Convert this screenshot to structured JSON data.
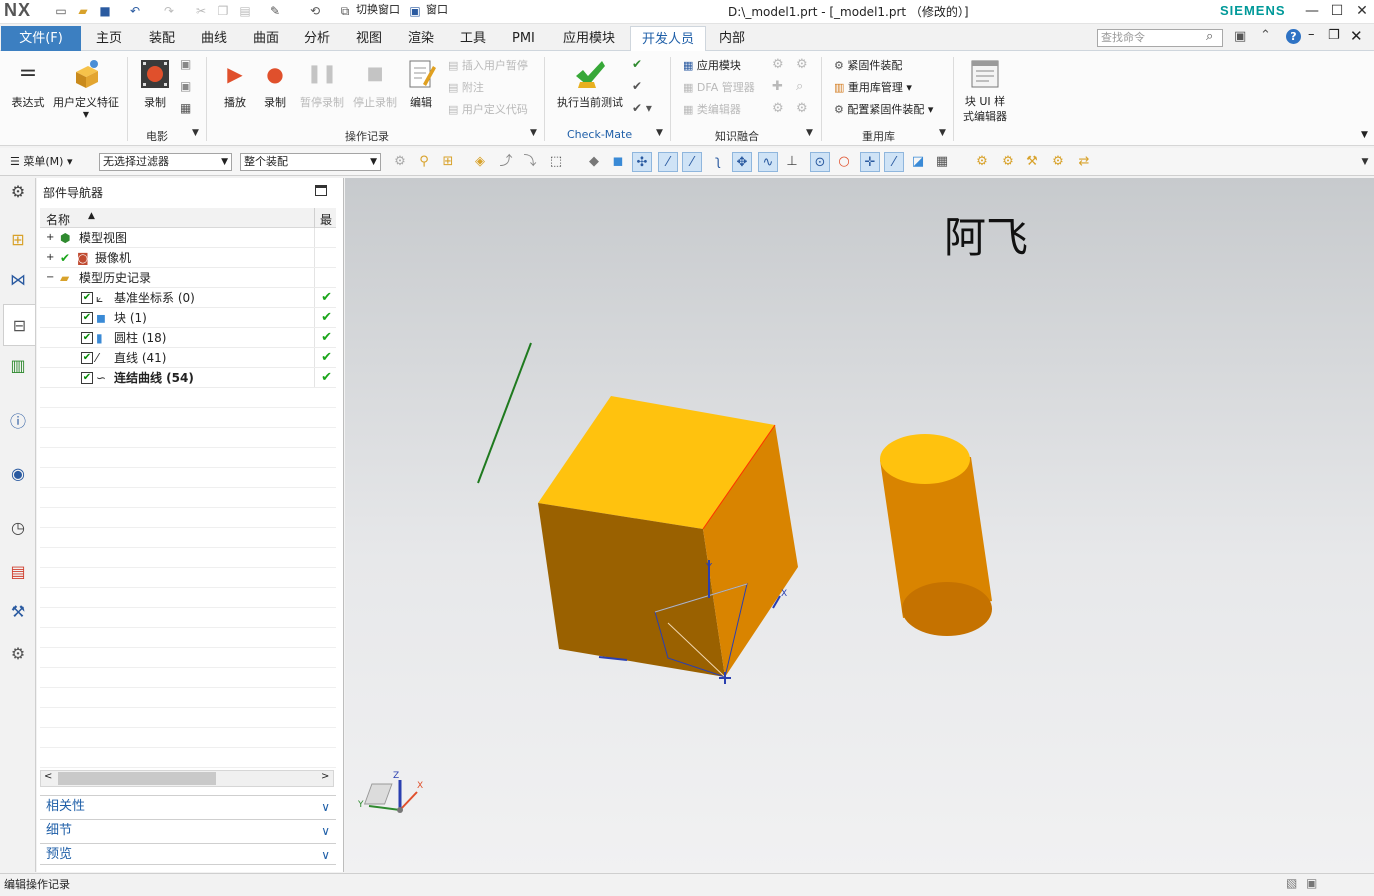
{
  "app": {
    "logo": "NX",
    "title": "D:\\_model1.prt - [_model1.prt （修改的）]",
    "brand": "SIEMENS",
    "switch_window": "切换窗口",
    "window_menu": "窗口"
  },
  "tabs": {
    "file": "文件(F)",
    "items": [
      "主页",
      "装配",
      "曲线",
      "曲面",
      "分析",
      "视图",
      "渲染",
      "工具",
      "PMI",
      "应用模块",
      "开发人员",
      "内部"
    ],
    "active": "开发人员"
  },
  "search": {
    "placeholder": "查找命令"
  },
  "ribbon": {
    "expression": "表达式",
    "udf": "用户定义特征",
    "movie": {
      "record": "录制",
      "label": "电影"
    },
    "ops": {
      "play": "播放",
      "record": "录制",
      "pause": "暂停录制",
      "stop": "停止录制",
      "edit": "编辑",
      "insert_pause": "插入用户暂停",
      "note": "附注",
      "user_code": "用户定义代码",
      "label": "操作记录"
    },
    "checkmate": {
      "run": "执行当前测试",
      "label": "Check-Mate"
    },
    "knowledge": {
      "app_module": "应用模块",
      "dfa": "DFA 管理器",
      "class_editor": "类编辑器",
      "label": "知识融合"
    },
    "reuse": {
      "fastener": "紧固件装配",
      "lib_mgr": "重用库管理",
      "config_fastener": "配置紧固件装配",
      "label": "重用库"
    },
    "block_ui": "块 UI 样式编辑器"
  },
  "toolbar": {
    "menu": "菜单(M)",
    "filter": "无选择过滤器",
    "assembly": "整个装配"
  },
  "navigator": {
    "title": "部件导航器",
    "col_name": "名称",
    "col_last": "最",
    "rows": [
      {
        "label": "模型视图"
      },
      {
        "label": "摄像机"
      },
      {
        "label": "模型历史记录"
      },
      {
        "label": "基准坐标系 (0)"
      },
      {
        "label": "块 (1)"
      },
      {
        "label": "圆柱 (18)"
      },
      {
        "label": "直线 (41)"
      },
      {
        "label": "连结曲线 (54)"
      }
    ],
    "panels": [
      "相关性",
      "细节",
      "预览"
    ]
  },
  "viewport": {
    "watermark": "阿飞",
    "triad": {
      "x": "X",
      "y": "Y",
      "z": "Z"
    }
  },
  "status": {
    "text": "编辑操作记录"
  },
  "colors": {
    "accent": "#3c7fc1",
    "solid_top": "#ffc20e",
    "solid_front": "#9a6100",
    "solid_side": "#d98400",
    "line": "#1f7a1f"
  }
}
